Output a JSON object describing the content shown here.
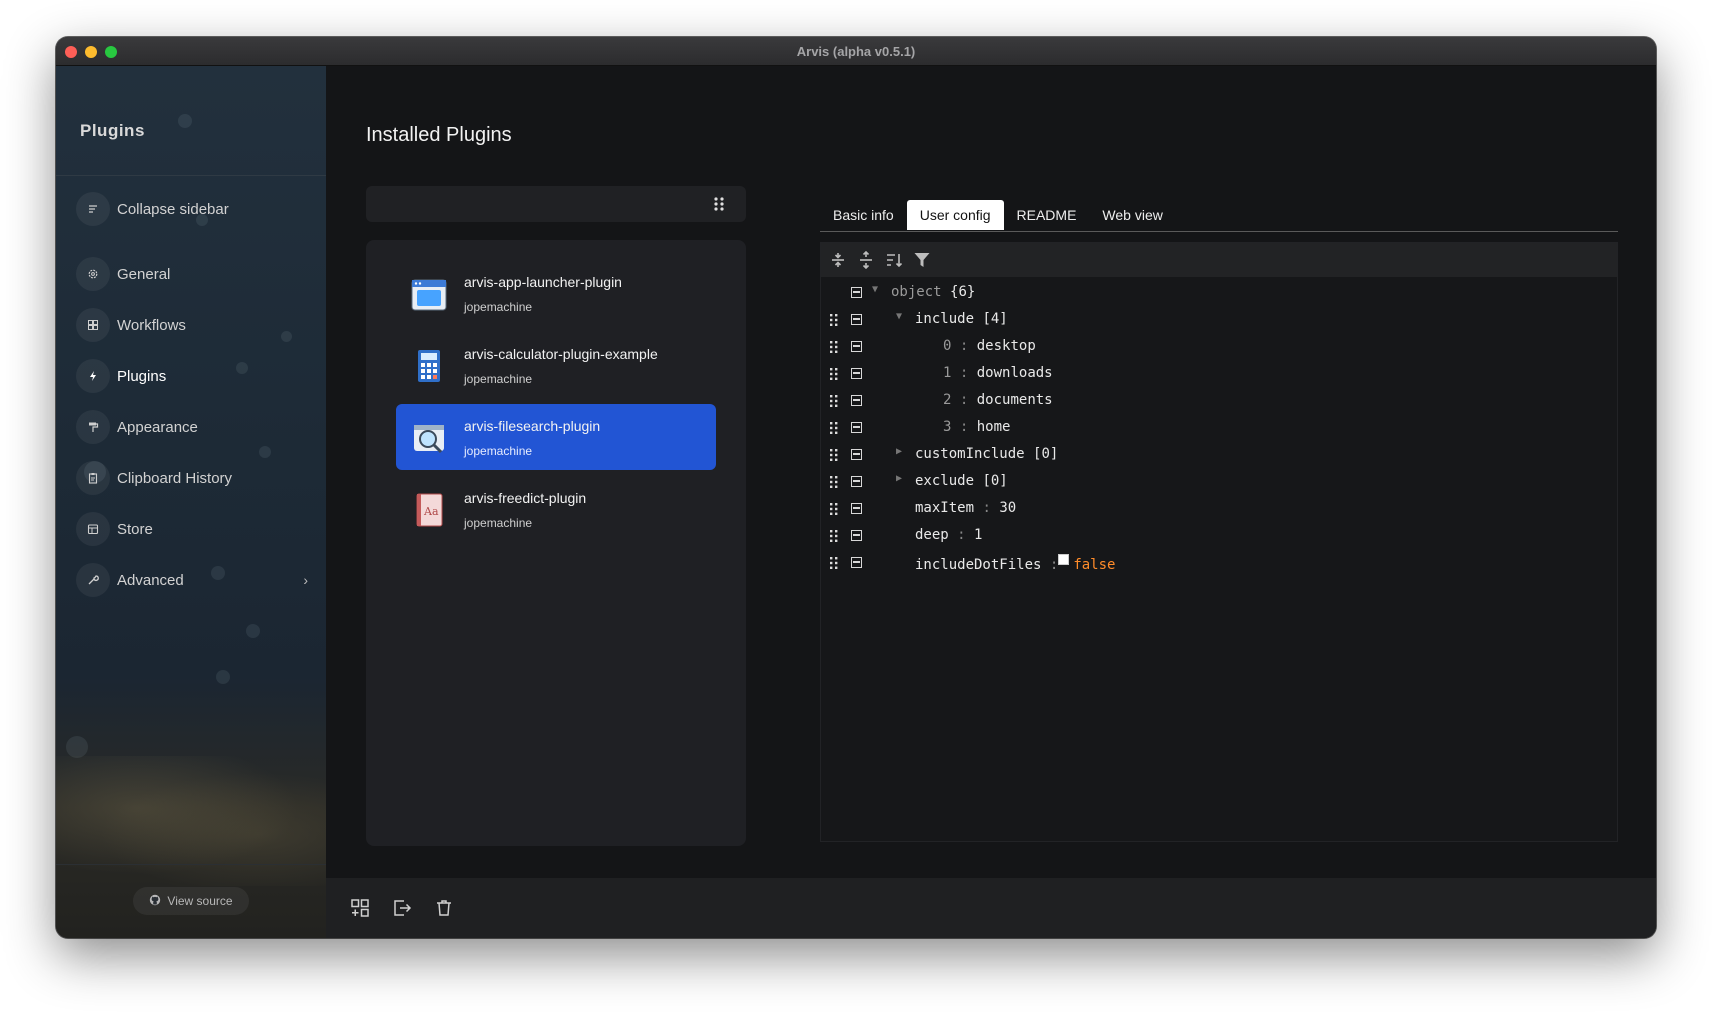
{
  "window": {
    "title": "Arvis (alpha v0.5.1)"
  },
  "sidebar": {
    "title": "Plugins",
    "items": [
      {
        "label": "Collapse sidebar",
        "icon": "collapse-icon"
      },
      {
        "label": "General",
        "icon": "gear-icon"
      },
      {
        "label": "Workflows",
        "icon": "workflows-icon"
      },
      {
        "label": "Plugins",
        "icon": "bolt-icon",
        "active": true
      },
      {
        "label": "Appearance",
        "icon": "paint-roller-icon"
      },
      {
        "label": "Clipboard History",
        "icon": "clipboard-icon"
      },
      {
        "label": "Store",
        "icon": "store-icon"
      },
      {
        "label": "Advanced",
        "icon": "wrench-icon",
        "has_submenu": true
      }
    ],
    "view_source": {
      "label": "View source",
      "icon": "github-icon"
    }
  },
  "main": {
    "title": "Installed Plugins",
    "search": {
      "value": "",
      "placeholder": ""
    },
    "plugins": [
      {
        "name": "arvis-app-launcher-plugin",
        "author": "jopemachine",
        "icon": "app-window-icon"
      },
      {
        "name": "arvis-calculator-plugin-example",
        "author": "jopemachine",
        "icon": "calculator-icon"
      },
      {
        "name": "arvis-filesearch-plugin",
        "author": "jopemachine",
        "icon": "file-search-icon",
        "selected": true
      },
      {
        "name": "arvis-freedict-plugin",
        "author": "jopemachine",
        "icon": "dictionary-icon"
      }
    ],
    "accent_color": "#2255d4"
  },
  "detail": {
    "tabs": [
      {
        "label": "Basic info"
      },
      {
        "label": "User config",
        "active": true
      },
      {
        "label": "README"
      },
      {
        "label": "Web view"
      }
    ],
    "json": {
      "root": {
        "key": "object",
        "count": "{6}"
      },
      "include": {
        "key": "include",
        "count": "[4]",
        "items": [
          {
            "index": "0",
            "value": "desktop"
          },
          {
            "index": "1",
            "value": "downloads"
          },
          {
            "index": "2",
            "value": "documents"
          },
          {
            "index": "3",
            "value": "home"
          }
        ]
      },
      "customInclude": {
        "key": "customInclude",
        "count": "[0]"
      },
      "exclude": {
        "key": "exclude",
        "count": "[0]"
      },
      "maxItem": {
        "key": "maxItem",
        "value": "30"
      },
      "deep": {
        "key": "deep",
        "value": "1"
      },
      "includeDotFiles": {
        "key": "includeDotFiles",
        "value": "false"
      },
      "separator": ":"
    }
  }
}
